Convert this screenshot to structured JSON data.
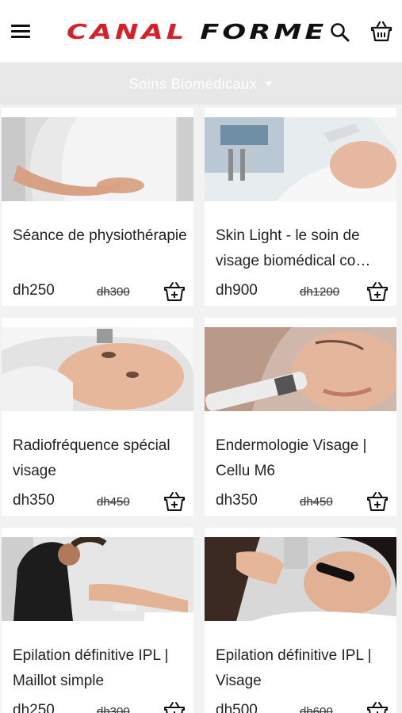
{
  "header": {
    "logo_part1": "CANAL",
    "logo_part2": "FORME",
    "brand_color": "#d61f26",
    "icons": [
      "menu-icon",
      "search-icon",
      "cart-icon"
    ]
  },
  "filter": {
    "label": "Soins Biomédicaux"
  },
  "products": [
    {
      "title": "Séance de physiothérapie",
      "price": "dh250",
      "old_price": "dh300"
    },
    {
      "title": "Skin Light - le soin de visage biomédical co…",
      "price": "dh900",
      "old_price": "dh1200"
    },
    {
      "title": "Radiofréquence spécial visage",
      "price": "dh350",
      "old_price": "dh450"
    },
    {
      "title": "Endermologie Visage | Cellu M6",
      "price": "dh350",
      "old_price": "dh450"
    },
    {
      "title": "Epilation définitive IPL | Maillot simple",
      "price": "dh250",
      "old_price": "dh300"
    },
    {
      "title": "Epilation définitive IPL | Visage",
      "price": "dh500",
      "old_price": "dh600"
    }
  ]
}
